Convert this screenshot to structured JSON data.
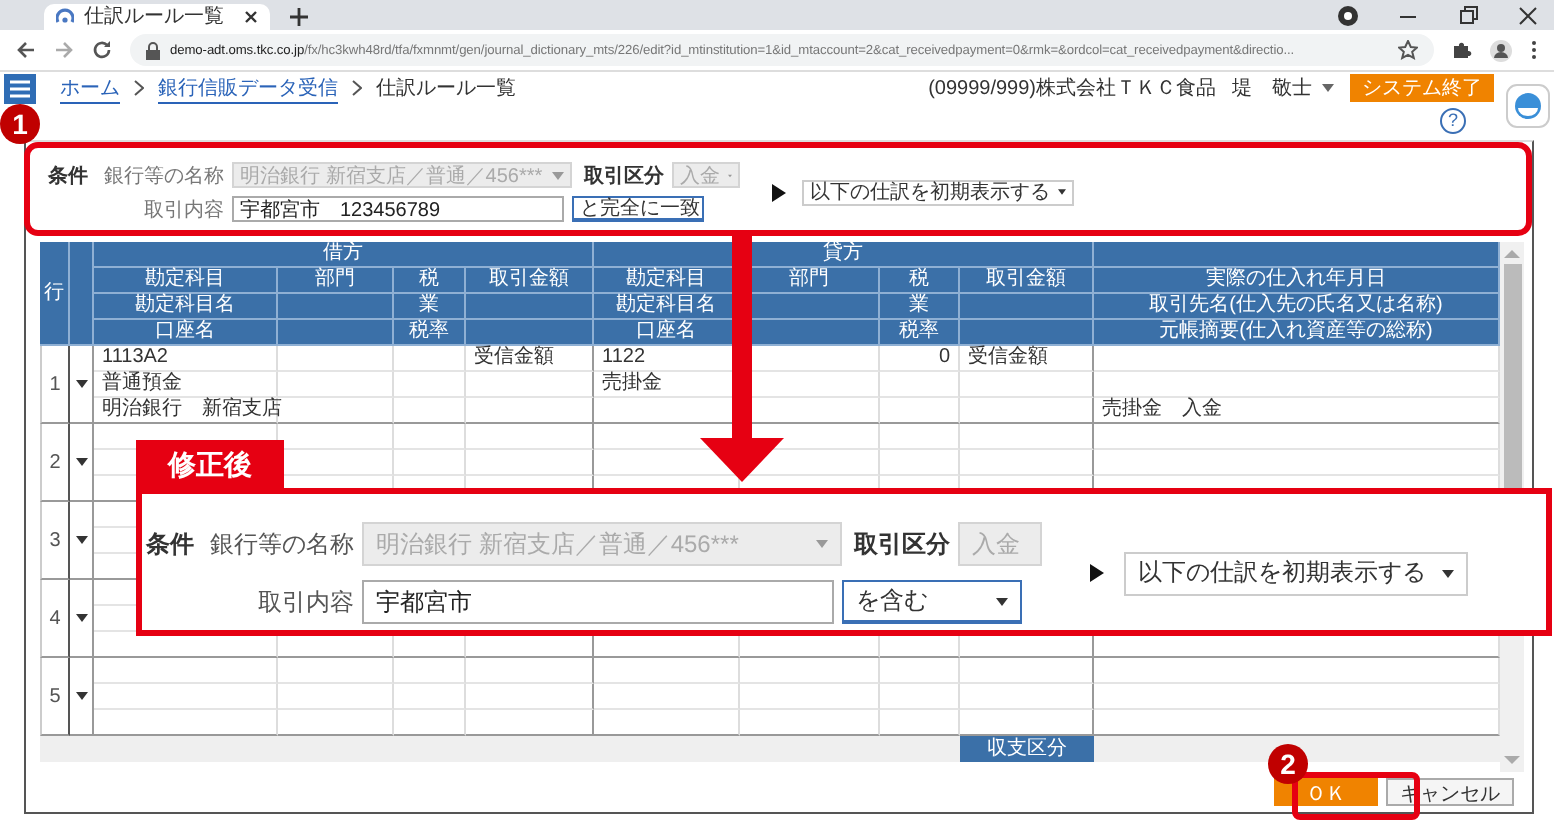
{
  "browser": {
    "tab_title": "仕訳ルール一覧",
    "url_host": "demo-adt.oms.tkc.co.jp",
    "url_path": "/fx/hc3kwh48rd/tfa/fxmnmt/gen/journal_dictionary_mts/226/edit?id_mtinstitution=1&id_mtaccount=2&cat_receivedpayment=0&rmk=&ordcol=cat_receivedpayment&directio..."
  },
  "header": {
    "breadcrumbs": [
      {
        "label": "ホーム",
        "link": true
      },
      {
        "label": "銀行信販データ受信",
        "link": true
      },
      {
        "label": "仕訳ルール一覧",
        "link": false
      }
    ],
    "company": "(09999/999)株式会社ＴＫＣ食品",
    "user": "堤　敬士",
    "exit_button": "システム終了",
    "help": "?"
  },
  "conditions": {
    "title": "条件",
    "bank": {
      "label": "銀行等の名称",
      "value": "明治銀行 新宿支店／普通／456***",
      "disabled": true
    },
    "type": {
      "label": "取引区分",
      "value": "入金",
      "disabled": true
    },
    "content": {
      "label": "取引内容",
      "value": "宇都宮市　123456789",
      "match": "と完全に一致"
    },
    "display": "以下の仕訳を初期表示する"
  },
  "table": {
    "row_header": "行",
    "groups": [
      {
        "title": "借方",
        "columns": [
          {
            "lines": [
              "勘定科目",
              "勘定科目名",
              "口座名"
            ]
          },
          {
            "lines": [
              "部門"
            ]
          },
          {
            "lines": [
              "税",
              "業",
              "税率"
            ]
          },
          {
            "lines": [
              "取引金額"
            ]
          }
        ]
      },
      {
        "title": "貸方",
        "columns": [
          {
            "lines": [
              "勘定科目",
              "勘定科目名",
              "口座名"
            ]
          },
          {
            "lines": [
              "部門"
            ]
          },
          {
            "lines": [
              "税",
              "業",
              "税率"
            ]
          },
          {
            "lines": [
              "取引金額"
            ]
          }
        ]
      }
    ],
    "extra_column": {
      "lines": [
        "実際の仕入れ年月日",
        "取引先名(仕入先の氏名又は名称)",
        "元帳摘要(仕入れ資産等の総称)"
      ]
    },
    "rows": [
      {
        "number": "1",
        "lines": [
          {
            "debit_account": "1113A2",
            "debit_amount": "受信金額",
            "credit_account": "1122",
            "credit_tax": "0",
            "credit_amount": "受信金額"
          },
          {
            "debit_account": "普通預金",
            "credit_account": "売掛金"
          },
          {
            "debit_account": "明治銀行　新宿支店",
            "extra": "売掛金　入金"
          }
        ]
      },
      {
        "number": "2"
      },
      {
        "number": "3"
      },
      {
        "number": "4"
      },
      {
        "number": "5"
      }
    ],
    "footer": "収支区分"
  },
  "buttons": [
    {
      "label": "ＯＫ",
      "primary": true
    },
    {
      "label": "キャンセル",
      "primary": false
    }
  ],
  "annotations": {
    "step_badges": [
      "1",
      "2"
    ],
    "callout": {
      "title": "修正後",
      "conditions": {
        "title": "条件",
        "bank": {
          "label": "銀行等の名称",
          "value": "明治銀行 新宿支店／普通／456***",
          "disabled": true
        },
        "type": {
          "label": "取引区分",
          "value": "入金",
          "disabled": true
        },
        "content": {
          "label": "取引内容",
          "value": "宇都宮市",
          "match": "を含む"
        },
        "display": "以下の仕訳を初期表示する"
      }
    }
  }
}
